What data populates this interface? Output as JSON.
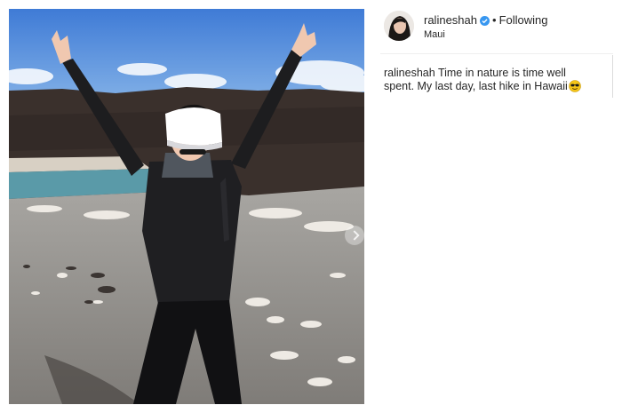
{
  "post": {
    "author": {
      "username": "ralineshah",
      "verified": true,
      "follow_state": "Following",
      "location": "Maui"
    },
    "caption": {
      "username": "ralineshah",
      "text": "Time in nature is time well spent. My last day, last hike in Hawaii",
      "emoji": "sunglasses-emoji"
    },
    "photo": {
      "subject": "hiker-with-raised-arms"
    }
  },
  "colors": {
    "text": "#262626",
    "verified_badge": "#3897f0",
    "divider": "#efefef",
    "sky": "#4a86d8",
    "lava_rock": "#3a302c",
    "water": "#5a9aa8",
    "gravel": "#8f8c88"
  },
  "icons": {
    "verified": "verified-badge-icon",
    "carousel": "chevron-right-icon"
  }
}
